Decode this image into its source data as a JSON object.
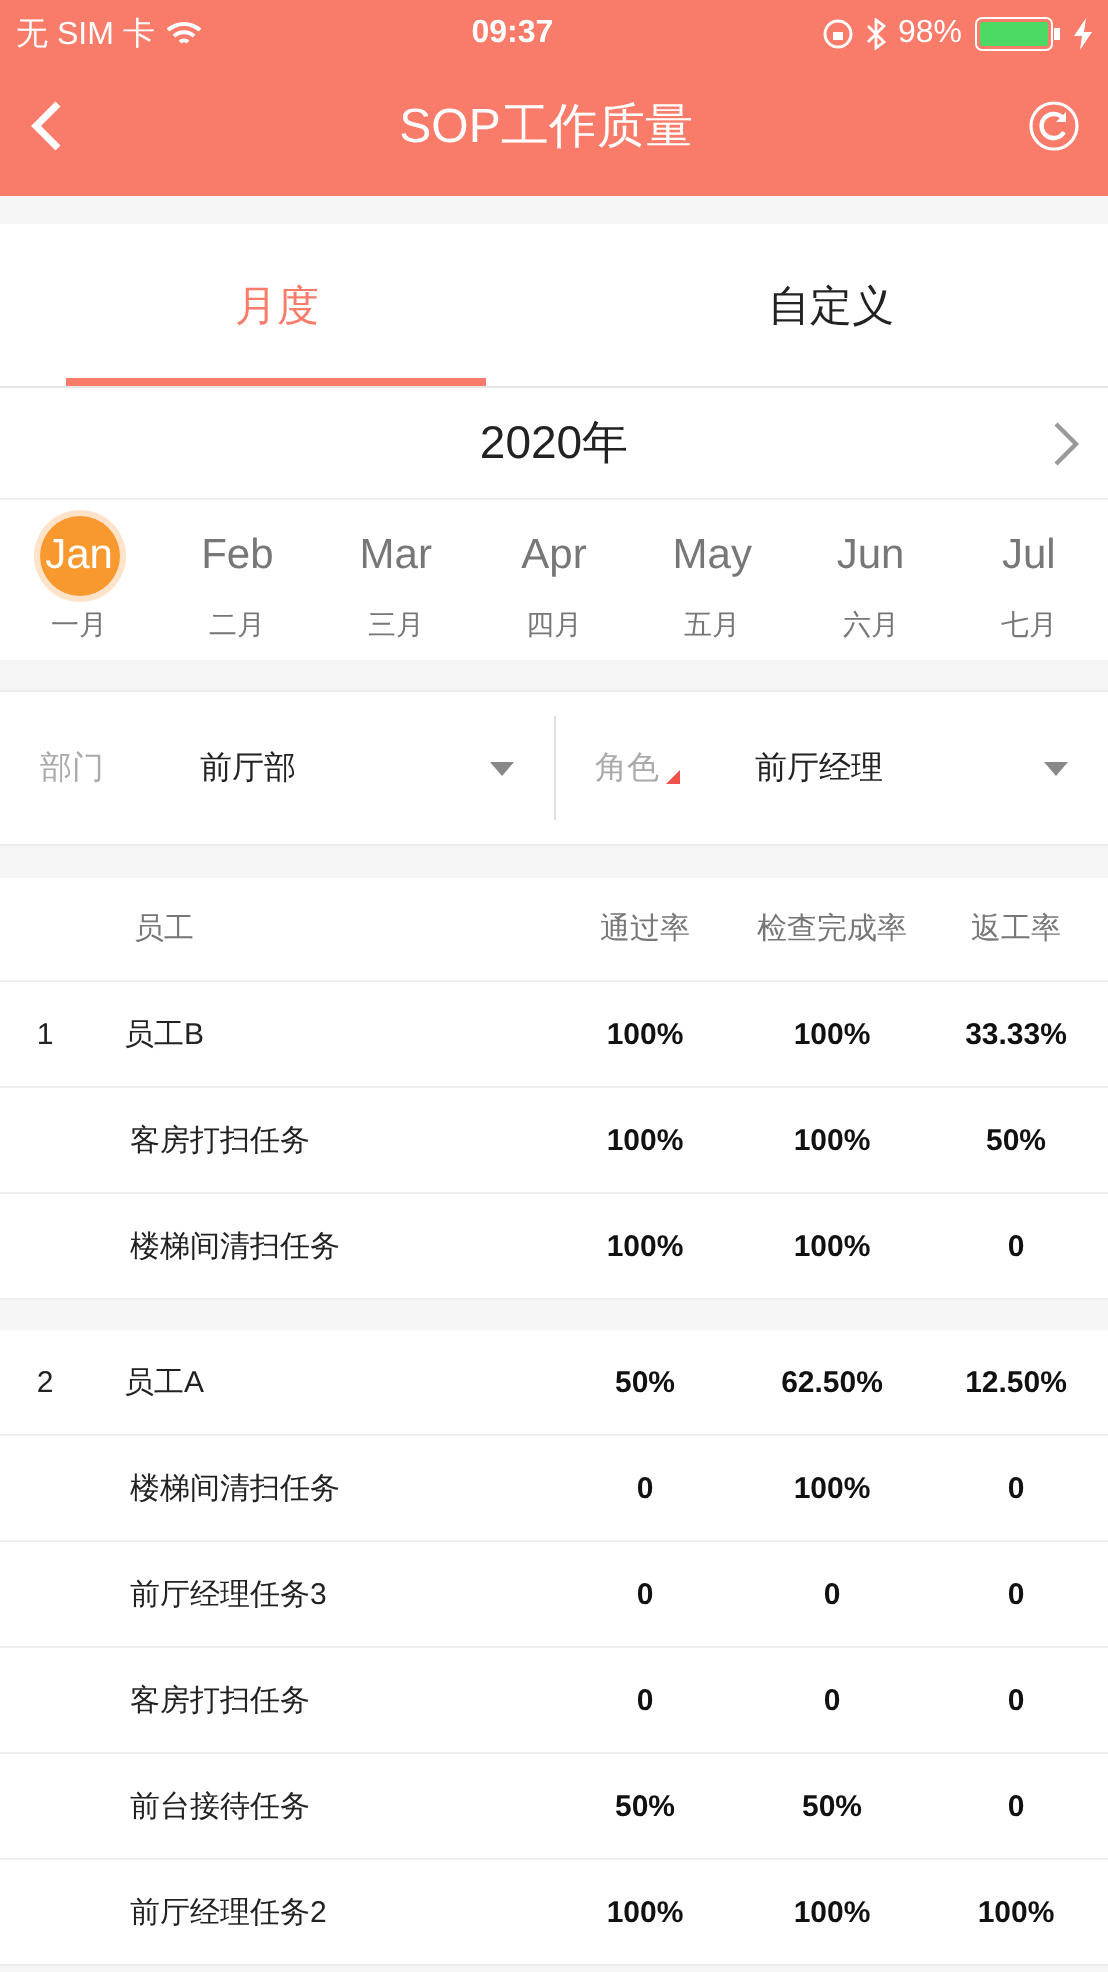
{
  "status_bar": {
    "carrier": "无 SIM 卡",
    "time": "09:37",
    "battery": "98%"
  },
  "nav": {
    "title": "SOP工作质量"
  },
  "tabs": [
    {
      "label": "月度",
      "selected": true
    },
    {
      "label": "自定义",
      "selected": false
    }
  ],
  "year": "2020年",
  "months": [
    {
      "label": "Jan",
      "chinese": "一月",
      "selected": true
    },
    {
      "label": "Feb",
      "chinese": "二月",
      "selected": false
    },
    {
      "label": "Mar",
      "chinese": "三月",
      "selected": false
    },
    {
      "label": "Apr",
      "chinese": "四月",
      "selected": false
    },
    {
      "label": "May",
      "chinese": "五月",
      "selected": false
    },
    {
      "label": "Jun",
      "chinese": "六月",
      "selected": false
    },
    {
      "label": "Jul",
      "chinese": "七月",
      "selected": false
    }
  ],
  "filters": [
    {
      "label": "部门",
      "value": "前厅部",
      "marked": false
    },
    {
      "label": "角色",
      "value": "前厅经理",
      "marked": true
    }
  ],
  "table": {
    "columns": [
      "员工",
      "通过率",
      "检查完成率",
      "返工率"
    ],
    "groups": [
      {
        "index": "1",
        "name": "员工B",
        "values": [
          "100%",
          "100%",
          "33.33%"
        ],
        "tasks": [
          {
            "name": "客房打扫任务",
            "values": [
              "100%",
              "100%",
              "50%"
            ]
          },
          {
            "name": "楼梯间清扫任务",
            "values": [
              "100%",
              "100%",
              "0"
            ]
          }
        ]
      },
      {
        "index": "2",
        "name": "员工A",
        "values": [
          "50%",
          "62.50%",
          "12.50%"
        ],
        "tasks": [
          {
            "name": "楼梯间清扫任务",
            "values": [
              "0",
              "100%",
              "0"
            ]
          },
          {
            "name": "前厅经理任务3",
            "values": [
              "0",
              "0",
              "0"
            ]
          },
          {
            "name": "客房打扫任务",
            "values": [
              "0",
              "0",
              "0"
            ]
          },
          {
            "name": "前台接待任务",
            "values": [
              "50%",
              "50%",
              "0"
            ]
          },
          {
            "name": "前厅经理任务2",
            "values": [
              "100%",
              "100%",
              "100%"
            ]
          }
        ]
      }
    ]
  }
}
